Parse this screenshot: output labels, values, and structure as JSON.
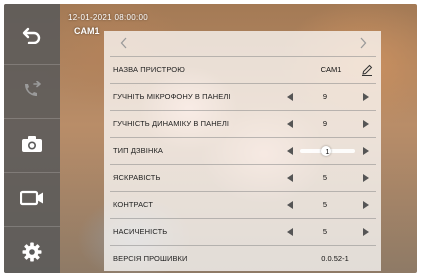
{
  "osd": {
    "datetime": "12-01-2021  08:00:00",
    "camera": "CAM1"
  },
  "sidebar": {
    "items": [
      {
        "icon": "back-icon"
      },
      {
        "icon": "call-transfer-icon"
      },
      {
        "icon": "camera-icon"
      },
      {
        "icon": "video-record-icon"
      },
      {
        "icon": "settings-gear-icon"
      }
    ]
  },
  "settings": {
    "rows": [
      {
        "label": "НАЗВА ПРИСТРОЮ",
        "value": "CAM1",
        "control": "edit"
      },
      {
        "label": "ГУЧНІТЬ МІКРОФОНУ В ПАНЕЛІ",
        "value": "9",
        "control": "stepper"
      },
      {
        "label": "ГУЧНІСТЬ ДИНАМІКУ В ПАНЕЛІ",
        "value": "9",
        "control": "stepper"
      },
      {
        "label": "ТИП ДЗВІНКА",
        "value": "1",
        "control": "stepper"
      },
      {
        "label": "ЯСКРАВІСТЬ",
        "value": "5",
        "control": "stepper"
      },
      {
        "label": "КОНТРАСТ",
        "value": "5",
        "control": "stepper"
      },
      {
        "label": "НАСИЧЕНІСТЬ",
        "value": "5",
        "control": "stepper"
      },
      {
        "label": "ВЕРСІЯ ПРОШИВКИ",
        "value": "0.0.52-1",
        "control": "none"
      }
    ]
  },
  "colors": {
    "sidebar_bg": "#5a5a5a",
    "panel_bg": "#ffffff",
    "icon": "#ffffff"
  }
}
